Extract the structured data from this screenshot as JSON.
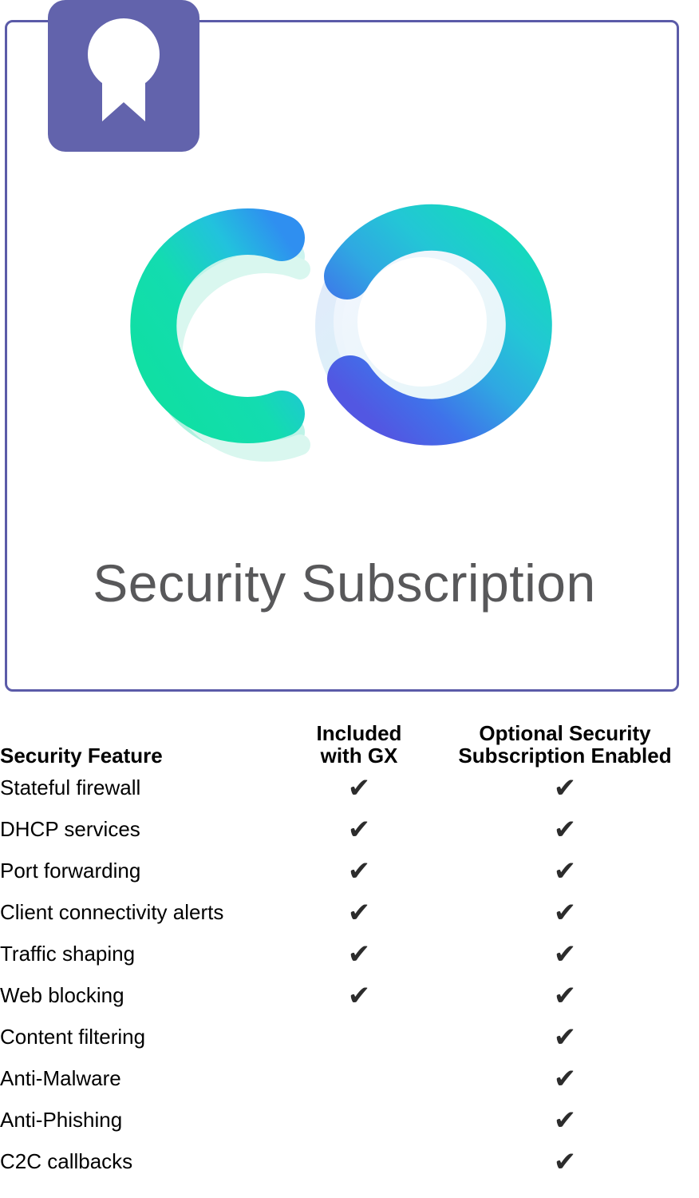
{
  "card": {
    "badge_icon": "award-ribbon-icon",
    "badge_color": "#6263ac",
    "border_color": "#5b5ba8",
    "logo_icon": "go-logo-icon",
    "product_title": "Security Subscription"
  },
  "table": {
    "headers": {
      "feature": "Security Feature",
      "gx_line1": "Included",
      "gx_line2": "with GX",
      "sub_line1": "Optional Security",
      "sub_line2": "Subscription Enabled"
    },
    "check_glyph": "✔",
    "rows": [
      {
        "feature": "Stateful firewall",
        "gx": "✔",
        "sub": "✔"
      },
      {
        "feature": "DHCP services",
        "gx": "✔",
        "sub": "✔"
      },
      {
        "feature": "Port forwarding",
        "gx": "✔",
        "sub": "✔"
      },
      {
        "feature": "Client connectivity alerts",
        "gx": "✔",
        "sub": "✔"
      },
      {
        "feature": "Traffic shaping",
        "gx": "✔",
        "sub": "✔"
      },
      {
        "feature": "Web blocking",
        "gx": "✔",
        "sub": "✔"
      },
      {
        "feature": "Content filtering",
        "gx": "",
        "sub": "✔"
      },
      {
        "feature": "Anti-Malware",
        "gx": "",
        "sub": "✔"
      },
      {
        "feature": "Anti-Phishing",
        "gx": "",
        "sub": "✔"
      },
      {
        "feature": "C2C callbacks",
        "gx": "",
        "sub": "✔"
      }
    ]
  },
  "colors": {
    "badge_purple": "#6263ac",
    "card_border": "#5b5ba8",
    "title_gray": "#58585a",
    "logo_green": "#14e09b",
    "logo_teal": "#1fc6c6",
    "logo_cyan": "#2ab7e8",
    "logo_blue": "#3b6ae8",
    "logo_indigo": "#5157e0",
    "logo_mint": "#9df0dc",
    "logo_pale": "#eef2fd",
    "check_dark": "#2c2c2c"
  }
}
